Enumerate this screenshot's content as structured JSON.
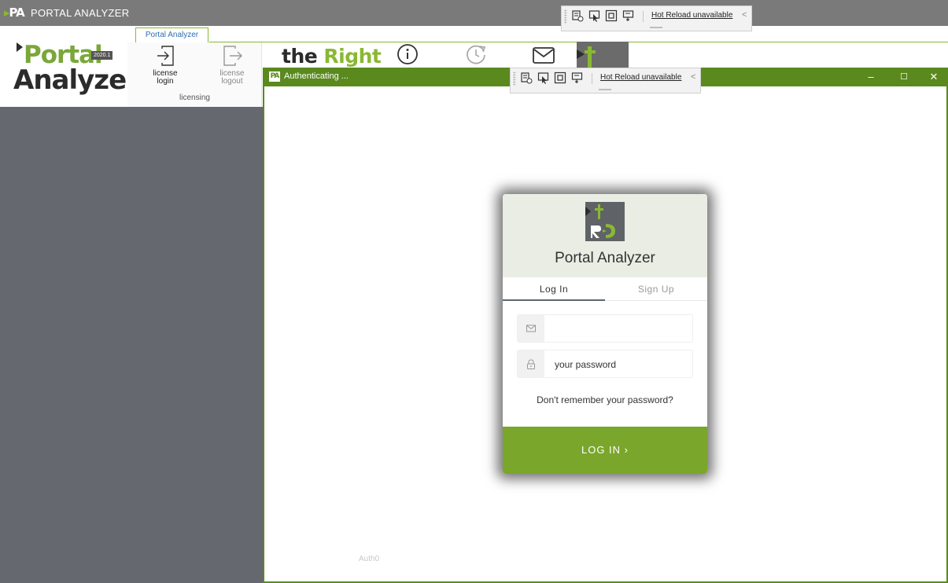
{
  "main_window": {
    "logo": "PA",
    "title": "PORTAL ANALYZER"
  },
  "ribbon": {
    "active_tab": "Portal Analyzer",
    "brand": {
      "line1": "Portal",
      "line2": "Analyzer",
      "version": "2020.1"
    },
    "license_login": {
      "line1": "license",
      "line2": "login"
    },
    "license_logout": {
      "line1": "license",
      "line2": "logout"
    },
    "group_label": "licensing",
    "the_right": {
      "part1": "the ",
      "part2": "Right"
    }
  },
  "hot_reload": {
    "label": "Hot Reload unavailable",
    "chevron": "<"
  },
  "auth_window": {
    "logo": "PA",
    "title": "Authenticating ...",
    "controls": {
      "minimize": "–",
      "maximize": "☐",
      "close": "✕"
    },
    "footer": "Auth0"
  },
  "login_card": {
    "app_name": "Portal Analyzer",
    "tabs": {
      "login": "Log In",
      "signup": "Sign Up"
    },
    "email": {
      "value": ""
    },
    "password": {
      "placeholder": "your password"
    },
    "forgot": "Don't remember your password?",
    "submit": "LOG IN ›"
  },
  "colors": {
    "accent_green": "#7aa62b",
    "window_green": "#5a8a1e",
    "left_panel": "#666870",
    "title_gray": "#7a7a7a"
  }
}
